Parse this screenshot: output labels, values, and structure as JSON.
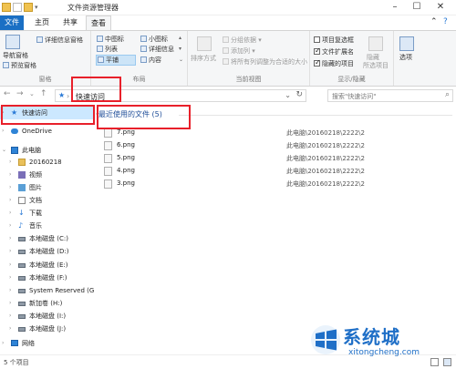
{
  "window": {
    "title": "文件资源管理器"
  },
  "ribbon_tabs": [
    "文件",
    "主页",
    "共享",
    "查看"
  ],
  "ribbon": {
    "pane_group": {
      "items": [
        "导航窗格",
        "预览窗格",
        "详细信息窗格"
      ],
      "label": "窗格"
    },
    "layout_group": {
      "items": [
        "中图标",
        "小图标",
        "列表",
        "详细信息",
        "平铺",
        "内容"
      ],
      "label": "布局"
    },
    "current_view_group": {
      "sort_label": "排序方式",
      "items": [
        "分组依据",
        "添加列",
        "将所有列调整为合适的大小"
      ],
      "label": "当前视图"
    },
    "show_hide_group": {
      "checkboxes": [
        {
          "label": "项目复选框",
          "checked": false
        },
        {
          "label": "文件扩展名",
          "checked": true
        },
        {
          "label": "隐藏的项目",
          "checked": true
        }
      ],
      "hide_selected": "隐藏",
      "hide_selected_sub": "所选项目",
      "label": "显示/隐藏"
    },
    "options_label": "选项"
  },
  "address_bar": {
    "breadcrumb": "快速访问",
    "search_placeholder": "搜索\"快速访问\""
  },
  "nav_pane": {
    "items": [
      {
        "label": "快速访问",
        "icon": "pin-icon",
        "arrow": "›",
        "level": 0,
        "selected": true
      },
      {
        "label": "OneDrive",
        "icon": "cloud-icon",
        "arrow": "›",
        "level": 0,
        "selected": false
      },
      {
        "label": "此电脑",
        "icon": "pc-icon",
        "arrow": "⌄",
        "level": 0,
        "selected": false
      },
      {
        "label": "20160218",
        "icon": "folder-icon",
        "arrow": "›",
        "level": 1,
        "selected": false
      },
      {
        "label": "视频",
        "icon": "video-icon",
        "arrow": "›",
        "level": 1,
        "selected": false
      },
      {
        "label": "图片",
        "icon": "picture-icon",
        "arrow": "›",
        "level": 1,
        "selected": false
      },
      {
        "label": "文档",
        "icon": "document-icon",
        "arrow": "›",
        "level": 1,
        "selected": false
      },
      {
        "label": "下载",
        "icon": "download-icon",
        "arrow": "›",
        "level": 1,
        "selected": false
      },
      {
        "label": "音乐",
        "icon": "music-icon",
        "arrow": "›",
        "level": 1,
        "selected": false
      },
      {
        "label": "本地磁盘 (C:)",
        "icon": "drive-icon",
        "arrow": "›",
        "level": 1,
        "selected": false
      },
      {
        "label": "本地磁盘 (D:)",
        "icon": "drive-icon",
        "arrow": "›",
        "level": 1,
        "selected": false
      },
      {
        "label": "本地磁盘 (E:)",
        "icon": "drive-icon",
        "arrow": "›",
        "level": 1,
        "selected": false
      },
      {
        "label": "本地磁盘 (F:)",
        "icon": "drive-icon",
        "arrow": "›",
        "level": 1,
        "selected": false
      },
      {
        "label": "System Reserved (G:",
        "icon": "drive-icon",
        "arrow": "›",
        "level": 1,
        "selected": false
      },
      {
        "label": "新加卷 (H:)",
        "icon": "drive-icon",
        "arrow": "›",
        "level": 1,
        "selected": false
      },
      {
        "label": "本地磁盘 (I:)",
        "icon": "drive-icon",
        "arrow": "›",
        "level": 1,
        "selected": false
      },
      {
        "label": "本地磁盘 (J:)",
        "icon": "drive-icon",
        "arrow": "›",
        "level": 1,
        "selected": false
      },
      {
        "label": "网络",
        "icon": "network-icon",
        "arrow": "›",
        "level": 0,
        "selected": false
      }
    ]
  },
  "content": {
    "group_header": "最近使用的文件 (5)",
    "files": [
      {
        "name": "7.png",
        "path": "此电脑\\20160218\\2222\\2"
      },
      {
        "name": "6.png",
        "path": "此电脑\\20160218\\2222\\2"
      },
      {
        "name": "5.png",
        "path": "此电脑\\20160218\\2222\\2"
      },
      {
        "name": "4.png",
        "path": "此电脑\\20160218\\2222\\2"
      },
      {
        "name": "3.png",
        "path": "此电脑\\20160218\\2222\\2"
      }
    ]
  },
  "status_bar": {
    "item_count": "5 个项目"
  },
  "watermark": {
    "brand": "系统城",
    "url": "xitongcheng.com"
  },
  "colors": {
    "accent": "#1a6fc4",
    "highlight_box": "#e8202a",
    "selection": "#cce8ff"
  }
}
